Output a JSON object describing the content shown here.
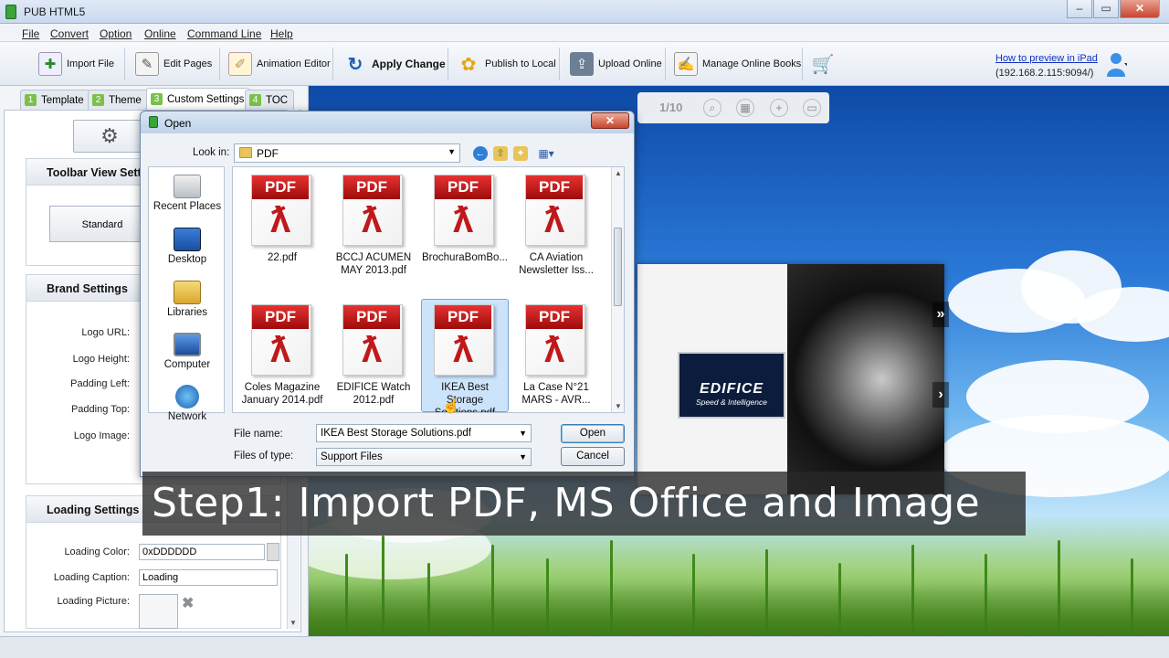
{
  "window": {
    "title": "PUB HTML5"
  },
  "menu": [
    "File",
    "Convert",
    "Option",
    "Online",
    "Command Line",
    "Help"
  ],
  "toolbar": {
    "import_file": "Import File",
    "edit_pages": "Edit Pages",
    "animation_editor": "Animation Editor",
    "apply_change": "Apply Change",
    "publish_local": "Publish to Local",
    "upload_online": "Upload Online",
    "manage_online": "Manage Online Books"
  },
  "ipad": {
    "link": "How to preview in iPad",
    "ip": "(192.168.2.115:9094/)"
  },
  "tabs": [
    {
      "num": "1",
      "label": "Template"
    },
    {
      "num": "2",
      "label": "Theme"
    },
    {
      "num": "3",
      "label": "Custom Settings"
    },
    {
      "num": "4",
      "label": "TOC"
    }
  ],
  "settings": {
    "toolbar_view": "Toolbar View Settings",
    "standard": "Standard",
    "brand": "Brand Settings",
    "logo_url": "Logo URL:",
    "logo_height": "Logo Height:",
    "padding_left": "Padding Left:",
    "padding_top": "Padding Top:",
    "logo_image": "Logo Image:",
    "loading": "Loading Settings",
    "loading_color_label": "Loading Color:",
    "loading_color_value": "0xDDDDDD",
    "loading_caption_label": "Loading Caption:",
    "loading_caption_value": "Loading",
    "loading_picture_label": "Loading Picture:"
  },
  "preview": {
    "page_counter": "1/10",
    "brand": "EDIFICE",
    "tagline": "Speed & Intelligence"
  },
  "dialog": {
    "title": "Open",
    "look_in_label": "Look in:",
    "look_in_value": "PDF",
    "places": [
      "Recent Places",
      "Desktop",
      "Libraries",
      "Computer",
      "Network"
    ],
    "files": [
      {
        "name": "22.pdf",
        "selected": false
      },
      {
        "name": "BCCJ ACUMEN MAY 2013.pdf",
        "selected": false
      },
      {
        "name": "BrochuraBomBo...",
        "selected": false
      },
      {
        "name": "CA Aviation Newsletter Iss...",
        "selected": false
      },
      {
        "name": "Coles Magazine January 2014.pdf",
        "selected": false
      },
      {
        "name": "EDIFICE Watch 2012.pdf",
        "selected": false
      },
      {
        "name": "IKEA Best Storage Solutions.pdf",
        "selected": true
      },
      {
        "name": "La Case N°21 MARS - AVR...",
        "selected": false
      }
    ],
    "pdf_badge": "PDF",
    "file_name_label": "File name:",
    "file_name_value": "IKEA Best Storage Solutions.pdf",
    "files_of_type_label": "Files of type:",
    "files_of_type_value": "Support Files",
    "open": "Open",
    "cancel": "Cancel"
  },
  "caption": "Step1: Import PDF, MS Office and Image"
}
